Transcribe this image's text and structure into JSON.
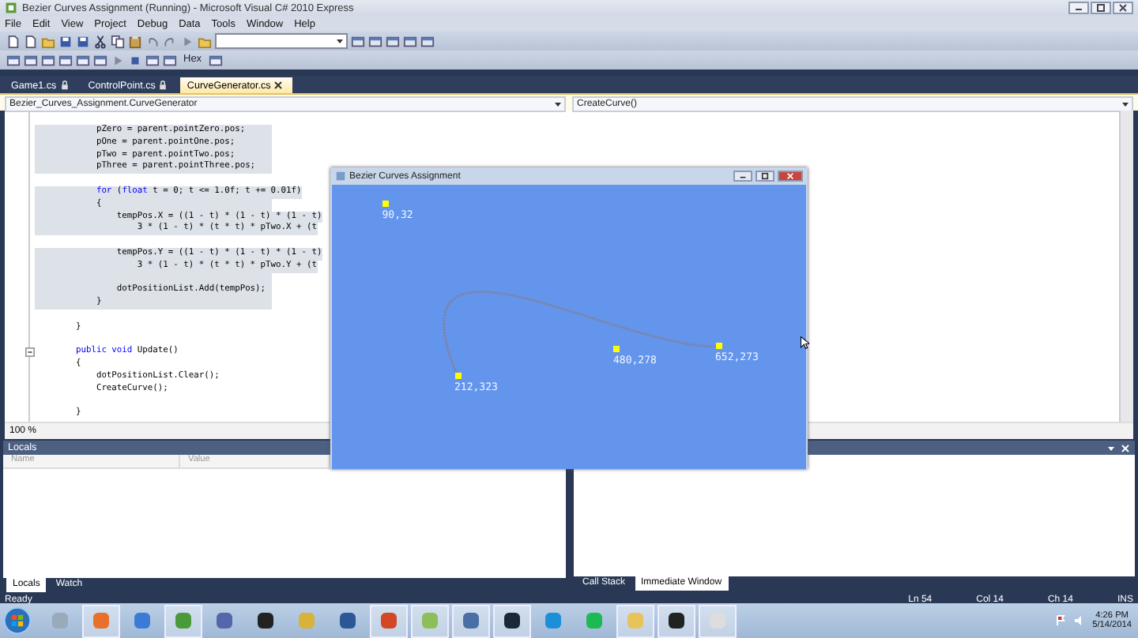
{
  "window": {
    "title": "Bezier Curves Assignment (Running) - Microsoft Visual C# 2010 Express"
  },
  "menu": [
    "File",
    "Edit",
    "View",
    "Project",
    "Debug",
    "Data",
    "Tools",
    "Window",
    "Help"
  ],
  "toolbar": {
    "hex_label": "Hex"
  },
  "tabs": [
    {
      "label": "Game1.cs",
      "locked": true,
      "selected": false
    },
    {
      "label": "ControlPoint.cs",
      "locked": true,
      "selected": false
    },
    {
      "label": "CurveGenerator.cs",
      "locked": false,
      "selected": true
    }
  ],
  "nav": {
    "type": "Bezier_Curves_Assignment.CurveGenerator",
    "member": "CreateCurve()"
  },
  "code": [
    {
      "selected": true,
      "parts": [
        {
          "kind": "plain",
          "text": "            pZero = parent.pointZero.pos;"
        }
      ]
    },
    {
      "selected": true,
      "parts": [
        {
          "kind": "plain",
          "text": "            pOne = parent.pointOne.pos;"
        }
      ]
    },
    {
      "selected": true,
      "parts": [
        {
          "kind": "plain",
          "text": "            pTwo = parent.pointTwo.pos;"
        }
      ]
    },
    {
      "selected": true,
      "parts": [
        {
          "kind": "plain",
          "text": "            pThree = parent.pointThree.pos;"
        }
      ]
    },
    {
      "kind": "blank"
    },
    {
      "selected": true,
      "parts": [
        {
          "kind": "keyword",
          "text": "            for"
        },
        {
          "kind": "plain",
          "text": " ("
        },
        {
          "kind": "keyword",
          "text": "float"
        },
        {
          "kind": "plain",
          "text": " t = 0; t <= 1.0f; t += 0.01f)"
        }
      ]
    },
    {
      "selected": true,
      "parts": [
        {
          "kind": "plain",
          "text": "            {"
        }
      ]
    },
    {
      "selected": true,
      "parts": [
        {
          "kind": "plain",
          "text": "                tempPos.X = ((1 - t) * (1 - t) * (1 - t)"
        }
      ]
    },
    {
      "selected": true,
      "parts": [
        {
          "kind": "plain",
          "text": "                    3 * (1 - t) * (t * t) * pTwo.X + (t"
        }
      ]
    },
    {
      "kind": "blank"
    },
    {
      "selected": true,
      "parts": [
        {
          "kind": "plain",
          "text": "                tempPos.Y = ((1 - t) * (1 - t) * (1 - t)"
        }
      ]
    },
    {
      "selected": true,
      "parts": [
        {
          "kind": "plain",
          "text": "                    3 * (1 - t) * (t * t) * pTwo.Y + (t"
        }
      ]
    },
    {
      "kind": "blank",
      "selected": true
    },
    {
      "selected": true,
      "parts": [
        {
          "kind": "plain",
          "text": "                dotPositionList.Add(tempPos);"
        }
      ]
    },
    {
      "selected": true,
      "parts": [
        {
          "kind": "plain",
          "text": "            }"
        }
      ]
    },
    {
      "kind": "blank"
    },
    {
      "selected": false,
      "parts": [
        {
          "kind": "plain",
          "text": "        }"
        }
      ]
    },
    {
      "kind": "blank"
    },
    {
      "selected": false,
      "collapsible": true,
      "parts": [
        {
          "kind": "keyword",
          "text": "        public void"
        },
        {
          "kind": "plain",
          "text": " Update()"
        }
      ]
    },
    {
      "selected": false,
      "parts": [
        {
          "kind": "plain",
          "text": "        {"
        }
      ]
    },
    {
      "selected": false,
      "parts": [
        {
          "kind": "plain",
          "text": "            dotPositionList.Clear();"
        }
      ]
    },
    {
      "selected": false,
      "parts": [
        {
          "kind": "plain",
          "text": "            CreateCurve();"
        }
      ]
    },
    {
      "kind": "blank"
    },
    {
      "selected": false,
      "parts": [
        {
          "kind": "plain",
          "text": "        }"
        }
      ]
    }
  ],
  "zoom": "100 %",
  "game_window": {
    "title": "Bezier Curves Assignment",
    "points": [
      {
        "label": "90,32"
      },
      {
        "label": "212,323"
      },
      {
        "label": "480,278"
      },
      {
        "label": "652,273"
      }
    ]
  },
  "locals": {
    "title": "Locals",
    "columns": [
      "Name",
      "Value"
    ]
  },
  "bottom_tabs_left": [
    {
      "label": "Locals",
      "selected": true
    },
    {
      "label": "Watch",
      "selected": false
    }
  ],
  "bottom_tabs_right": [
    {
      "label": "Call Stack",
      "selected": false
    },
    {
      "label": "Immediate Window",
      "selected": true
    }
  ],
  "status_bar": {
    "state": "Ready",
    "line": "Ln 54",
    "column": "Col 14",
    "char": "Ch 14",
    "mode": "INS"
  },
  "taskbar": {
    "apps": [
      {
        "running": false
      },
      {
        "running": true
      },
      {
        "running": false
      },
      {
        "running": true
      },
      {
        "running": false
      },
      {
        "running": false
      },
      {
        "running": false
      },
      {
        "running": false
      },
      {
        "running": true
      },
      {
        "running": true
      },
      {
        "running": true
      },
      {
        "running": true
      },
      {
        "running": false
      },
      {
        "running": false
      },
      {
        "running": true
      },
      {
        "running": true
      },
      {
        "running": true
      }
    ],
    "time": "4:26 PM",
    "date": "5/14/2014"
  }
}
